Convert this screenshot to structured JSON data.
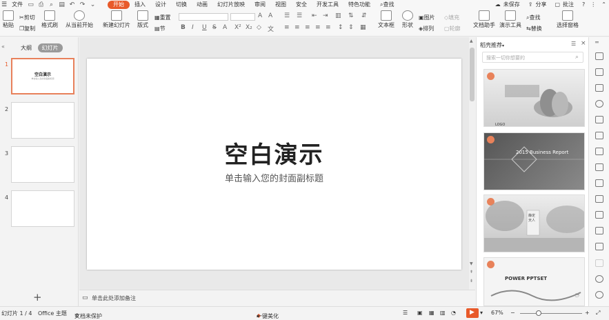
{
  "menubar": {
    "file": "文件",
    "tabs": [
      "开始",
      "插入",
      "设计",
      "切换",
      "动画",
      "幻灯片放映",
      "审阅",
      "视图",
      "安全",
      "开发工具",
      "特色功能"
    ],
    "search": "查找",
    "unsaved": "未保存",
    "share": "分享",
    "comment": "批注"
  },
  "ribbon": {
    "paste": "粘贴",
    "cut": "剪切",
    "copy": "复制",
    "format_painter": "格式刷",
    "from_current": "从当前开始",
    "new_slide": "新建幻灯片",
    "layout": "版式",
    "reset": "重置",
    "section": "节",
    "text_box": "文本框",
    "shape": "形状",
    "picture": "图片",
    "fill": "填充",
    "arrange": "排列",
    "outline": "轮廓",
    "doc_helper": "文档助手",
    "present_tools": "演示工具",
    "find": "查找",
    "replace": "替换",
    "select_pane": "选择窗格"
  },
  "left": {
    "tab_outline": "大纲",
    "tab_slides": "幻灯片",
    "slides": [
      {
        "num": "1",
        "title": "空白演示",
        "sub": "单击输入您的封面副标题"
      },
      {
        "num": "2"
      },
      {
        "num": "3"
      },
      {
        "num": "4"
      }
    ],
    "add": "+"
  },
  "slide": {
    "title": "空白演示",
    "subtitle": "单击输入您的封面副标题"
  },
  "notes": {
    "placeholder": "单击此处添加备注"
  },
  "rpanel": {
    "title": "稻壳推荐",
    "search_placeholder": "搜索一切你想要的",
    "templates": [
      {
        "caption": "LOGO"
      },
      {
        "caption": "2015 Business Report"
      },
      {
        "caption": "静定天人"
      },
      {
        "caption": "POWER PPTSET"
      }
    ]
  },
  "status": {
    "slide_count": "幻灯片 1 / 4",
    "theme": "Office 主题",
    "protect": "文档未保护",
    "beautify": "一键美化",
    "zoom": "67%"
  },
  "colors": {
    "accent": "#e85a2a",
    "selection": "#e8805a"
  }
}
